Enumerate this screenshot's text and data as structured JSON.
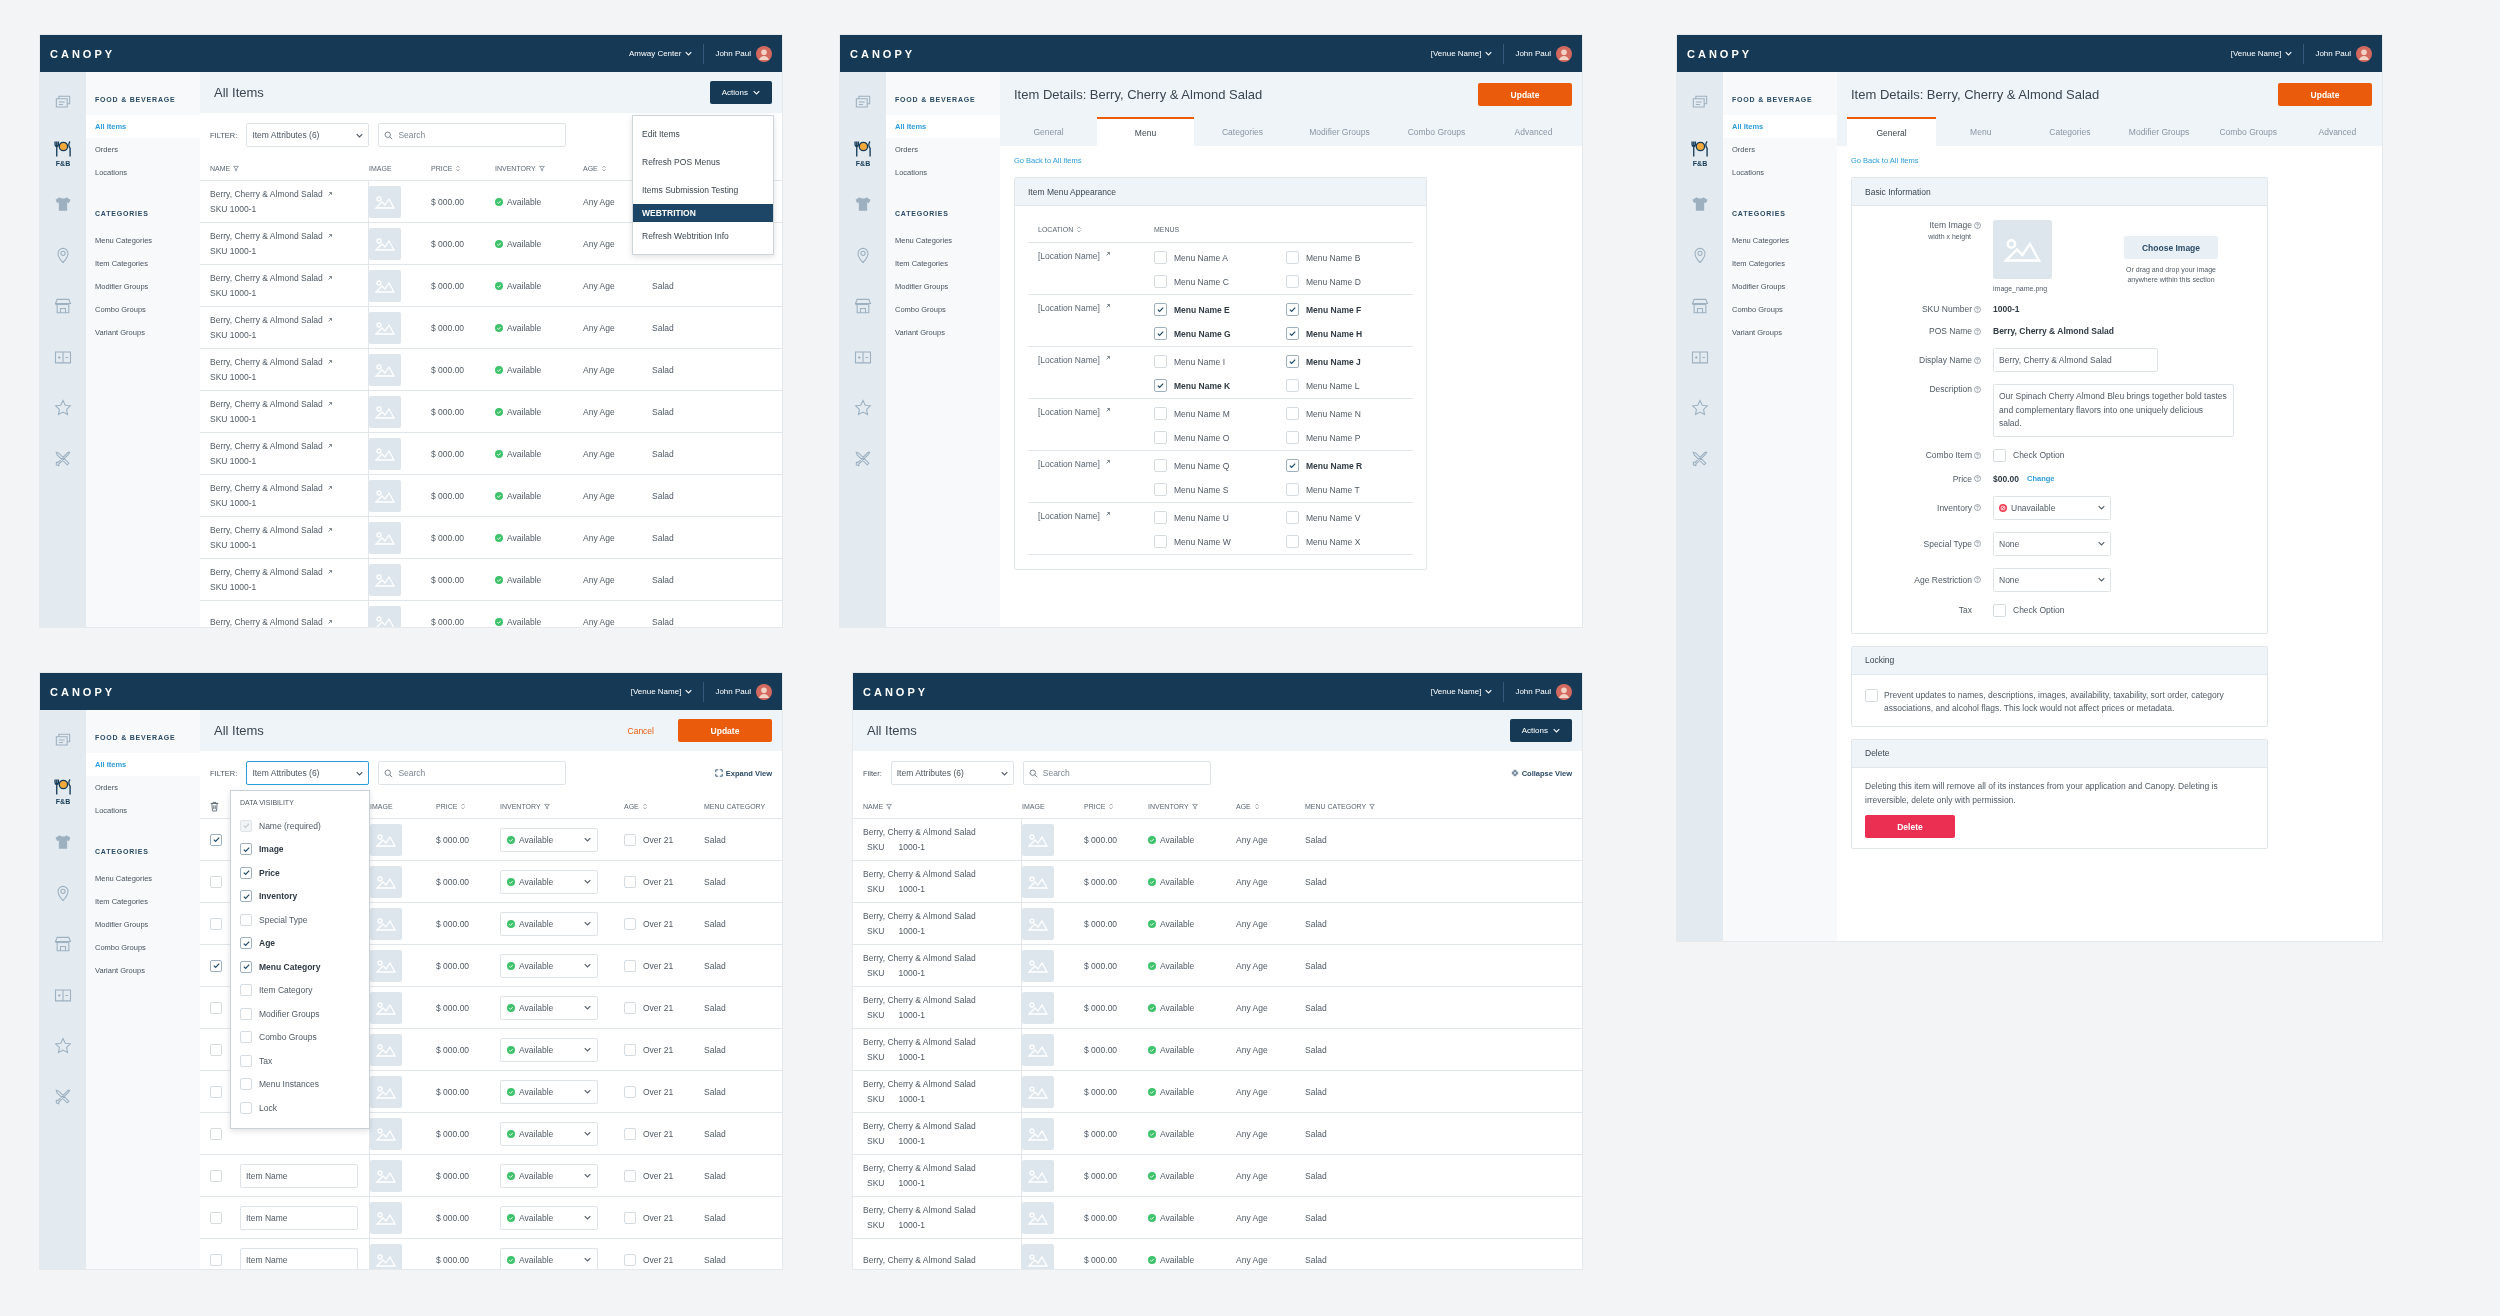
{
  "screens": [
    {
      "kind": "list",
      "topbar": {
        "logo": "CANOPY",
        "venue": "Amway Center",
        "user": "John Paul"
      },
      "rail": [
        {
          "kind": "tickets",
          "selected": false
        },
        {
          "kind": "food",
          "label": "F&B",
          "selected": true
        },
        {
          "kind": "shirt",
          "selected": false
        },
        {
          "kind": "pin",
          "selected": false
        },
        {
          "kind": "store",
          "selected": false
        },
        {
          "kind": "panels",
          "selected": false
        },
        {
          "kind": "star",
          "selected": false
        },
        {
          "kind": "tools",
          "selected": false
        }
      ],
      "sidebar": {
        "sections": [
          {
            "title": "FOOD & BEVERAGE",
            "items": [
              {
                "label": "All Items",
                "selected": true
              },
              {
                "label": "Orders",
                "selected": false
              },
              {
                "label": "Locations",
                "selected": false
              }
            ]
          },
          {
            "title": "CATEGORIES",
            "items": [
              {
                "label": "Menu Categories",
                "selected": false
              },
              {
                "label": "Item Categories",
                "selected": false
              },
              {
                "label": "Modifier Groups",
                "selected": false
              },
              {
                "label": "Combo Groups",
                "selected": false
              },
              {
                "label": "Variant Groups",
                "selected": false
              }
            ]
          }
        ]
      },
      "title": "All Items",
      "actions": [
        {
          "kind": "dropdown",
          "label": "Actions"
        }
      ],
      "filter": {
        "label": "FILTER:",
        "value": "Item Attributes (6)",
        "open": false
      },
      "search": {
        "placeholder": "Search"
      },
      "columns": [
        {
          "label": "NAME",
          "sortable": false,
          "filterable": true
        },
        {
          "label": "IMAGE",
          "sortable": false,
          "filterable": false
        },
        {
          "label": "PRICE",
          "sortable": true,
          "filterable": false
        },
        {
          "label": "INVENTORY",
          "sortable": false,
          "filterable": true
        },
        {
          "label": "AGE",
          "sortable": true,
          "filterable": false
        }
      ],
      "rows": [
        {
          "name": "Berry, Cherry & Almond Salad",
          "sku": "SKU 1000-1",
          "linked": true,
          "price": "$ 000.00",
          "inventory": "Available",
          "age": "Any Age"
        },
        {
          "name": "Berry, Cherry & Almond Salad",
          "sku": "SKU 1000-1",
          "linked": true,
          "price": "$ 000.00",
          "inventory": "Available",
          "age": "Any Age"
        },
        {
          "name": "Berry, Cherry & Almond Salad",
          "sku": "SKU 1000-1",
          "linked": true,
          "price": "$ 000.00",
          "inventory": "Available",
          "age": "Any Age",
          "category": "Salad"
        },
        {
          "name": "Berry, Cherry & Almond Salad",
          "sku": "SKU 1000-1",
          "linked": true,
          "price": "$ 000.00",
          "inventory": "Available",
          "age": "Any Age",
          "category": "Salad"
        },
        {
          "name": "Berry, Cherry & Almond Salad",
          "sku": "SKU 1000-1",
          "linked": true,
          "price": "$ 000.00",
          "inventory": "Available",
          "age": "Any Age",
          "category": "Salad"
        },
        {
          "name": "Berry, Cherry & Almond Salad",
          "sku": "SKU 1000-1",
          "linked": true,
          "price": "$ 000.00",
          "inventory": "Available",
          "age": "Any Age",
          "category": "Salad"
        },
        {
          "name": "Berry, Cherry & Almond Salad",
          "sku": "SKU 1000-1",
          "linked": true,
          "price": "$ 000.00",
          "inventory": "Available",
          "age": "Any Age",
          "category": "Salad"
        },
        {
          "name": "Berry, Cherry & Almond Salad",
          "sku": "SKU 1000-1",
          "linked": true,
          "price": "$ 000.00",
          "inventory": "Available",
          "age": "Any Age",
          "category": "Salad"
        },
        {
          "name": "Berry, Cherry & Almond Salad",
          "sku": "SKU 1000-1",
          "linked": true,
          "price": "$ 000.00",
          "inventory": "Available",
          "age": "Any Age",
          "category": "Salad"
        },
        {
          "name": "Berry, Cherry & Almond Salad",
          "sku": "SKU 1000-1",
          "linked": true,
          "price": "$ 000.00",
          "inventory": "Available",
          "age": "Any Age",
          "category": "Salad"
        },
        {
          "name": "Berry, Cherry & Almond Salad",
          "linked": true,
          "price": "$ 000.00",
          "inventory": "Available",
          "age": "Any Age",
          "category": "Salad"
        }
      ],
      "menu": {
        "items": [
          {
            "kind": "item",
            "label": "Edit Items"
          },
          {
            "kind": "item",
            "label": "Refresh POS Menus"
          },
          {
            "kind": "item",
            "label": "Items Submission Testing"
          },
          {
            "kind": "heading",
            "label": "WEBTRITION"
          },
          {
            "kind": "item",
            "label": "Refresh Webtrition Info"
          }
        ]
      }
    },
    {
      "kind": "menu",
      "topbar": {
        "logo": "CANOPY",
        "venue": "[Venue Name]",
        "user": "John Paul"
      },
      "rail": [
        {
          "kind": "tickets",
          "selected": false
        },
        {
          "kind": "food",
          "label": "F&B",
          "selected": true
        },
        {
          "kind": "shirt",
          "selected": false
        },
        {
          "kind": "pin",
          "selected": false
        },
        {
          "kind": "store",
          "selected": false
        },
        {
          "kind": "panels",
          "selected": false
        },
        {
          "kind": "star",
          "selected": false
        },
        {
          "kind": "tools",
          "selected": false
        }
      ],
      "sidebar": {
        "sections": [
          {
            "title": "FOOD & BEVERAGE",
            "items": [
              {
                "label": "All Items",
                "selected": true
              },
              {
                "label": "Orders",
                "selected": false
              },
              {
                "label": "Locations",
                "selected": false
              }
            ]
          },
          {
            "title": "CATEGORIES",
            "items": [
              {
                "label": "Menu Categories",
                "selected": false
              },
              {
                "label": "Item Categories",
                "selected": false
              },
              {
                "label": "Modifier Groups",
                "selected": false
              },
              {
                "label": "Combo Groups",
                "selected": false
              },
              {
                "label": "Variant Groups",
                "selected": false
              }
            ]
          }
        ]
      },
      "title": "Item Details: Berry, Cherry & Almond Salad",
      "actions": [
        {
          "kind": "primary",
          "label": "Update"
        }
      ],
      "tabs": [
        {
          "label": "General",
          "selected": false
        },
        {
          "label": "Menu",
          "selected": true
        },
        {
          "label": "Categories",
          "selected": false
        },
        {
          "label": "Modifier Groups",
          "selected": false
        },
        {
          "label": "Combo Groups",
          "selected": false
        },
        {
          "label": "Advanced",
          "selected": false
        }
      ],
      "back_link": "Go Back to All Items",
      "panel": {
        "title": "Item Menu Appearance",
        "location_header": "LOCATION",
        "menus_header": "MENUS",
        "groups": [
          {
            "location": "[Location Name]",
            "menus": [
              {
                "label": "Menu Name A",
                "checked": false
              },
              {
                "label": "Menu Name B",
                "checked": false
              },
              {
                "label": "Menu Name C",
                "checked": false
              },
              {
                "label": "Menu Name D",
                "checked": false
              }
            ]
          },
          {
            "location": "[Location Name]",
            "menus": [
              {
                "label": "Menu Name E",
                "checked": true
              },
              {
                "label": "Menu Name F",
                "checked": true
              },
              {
                "label": "Menu Name G",
                "checked": true
              },
              {
                "label": "Menu Name H",
                "checked": true
              }
            ]
          },
          {
            "location": "[Location Name]",
            "menus": [
              {
                "label": "Menu Name I",
                "checked": false
              },
              {
                "label": "Menu Name J",
                "checked": true
              },
              {
                "label": "Menu Name K",
                "checked": true
              },
              {
                "label": "Menu Name L",
                "checked": false
              }
            ]
          },
          {
            "location": "[Location Name]",
            "menus": [
              {
                "label": "Menu Name M",
                "checked": false
              },
              {
                "label": "Menu Name N",
                "checked": false
              },
              {
                "label": "Menu Name O",
                "checked": false
              },
              {
                "label": "Menu Name P",
                "checked": false
              }
            ]
          },
          {
            "location": "[Location Name]",
            "menus": [
              {
                "label": "Menu Name Q",
                "checked": false
              },
              {
                "label": "Menu Name R",
                "checked": true
              },
              {
                "label": "Menu Name S",
                "checked": false
              },
              {
                "label": "Menu Name T",
                "checked": false
              }
            ]
          },
          {
            "location": "[Location Name]",
            "menus": [
              {
                "label": "Menu Name U",
                "checked": false
              },
              {
                "label": "Menu Name V",
                "checked": false
              },
              {
                "label": "Menu Name W",
                "checked": false
              },
              {
                "label": "Menu Name X",
                "checked": false
              }
            ]
          }
        ]
      }
    },
    {
      "kind": "general",
      "topbar": {
        "logo": "CANOPY",
        "venue": "[Venue Name]",
        "user": "John Paul"
      },
      "rail": [
        {
          "kind": "tickets",
          "selected": false
        },
        {
          "kind": "food",
          "label": "F&B",
          "selected": true
        },
        {
          "kind": "shirt",
          "selected": false
        },
        {
          "kind": "pin",
          "selected": false
        },
        {
          "kind": "store",
          "selected": false
        },
        {
          "kind": "panels",
          "selected": false
        },
        {
          "kind": "star",
          "selected": false
        },
        {
          "kind": "tools",
          "selected": false
        }
      ],
      "sidebar": {
        "sections": [
          {
            "title": "FOOD & BEVERAGE",
            "items": [
              {
                "label": "All Items",
                "selected": true
              },
              {
                "label": "Orders",
                "selected": false
              },
              {
                "label": "Locations",
                "selected": false
              }
            ]
          },
          {
            "title": "CATEGORIES",
            "items": [
              {
                "label": "Menu Categories",
                "selected": false
              },
              {
                "label": "Item Categories",
                "selected": false
              },
              {
                "label": "Modifier Groups",
                "selected": false
              },
              {
                "label": "Combo Groups",
                "selected": false
              },
              {
                "label": "Variant Groups",
                "selected": false
              }
            ]
          }
        ]
      },
      "title": "Item Details: Berry, Cherry & Almond Salad",
      "actions": [
        {
          "kind": "primary",
          "label": "Update"
        }
      ],
      "tabs": [
        {
          "label": "General",
          "selected": true
        },
        {
          "label": "Menu",
          "selected": false
        },
        {
          "label": "Categories",
          "selected": false
        },
        {
          "label": "Modifier Groups",
          "selected": false
        },
        {
          "label": "Combo Groups",
          "selected": false
        },
        {
          "label": "Advanced",
          "selected": false
        }
      ],
      "back_link": "Go Back to All Items",
      "basic": {
        "title": "Basic Information",
        "fields": [
          {
            "kind": "image",
            "label": "Item Image",
            "help": true,
            "sublabel": "width x height",
            "caption": "image_name.png",
            "button": "Choose Image",
            "hint": "Or drag and drop your image anywhere within this section"
          },
          {
            "kind": "text",
            "label": "SKU Number",
            "help": true,
            "value": "1000-1"
          },
          {
            "kind": "text",
            "label": "POS Name",
            "help": true,
            "value": "Berry, Cherry & Almond Salad"
          },
          {
            "kind": "input",
            "label": "Display Name",
            "help": true,
            "value": "Berry, Cherry & Almond Salad"
          },
          {
            "kind": "textarea",
            "label": "Description",
            "help": true,
            "value": "Our Spinach Cherry Almond Bleu brings together bold tastes and complementary flavors into one uniquely delicious salad."
          },
          {
            "kind": "checkbox",
            "label": "Combo Item",
            "help": true,
            "option": "Check Option",
            "checked": false
          },
          {
            "kind": "price",
            "label": "Price",
            "help": true,
            "value": "$00.00",
            "link": "Change"
          },
          {
            "kind": "select",
            "label": "Inventory",
            "help": true,
            "value": "Unavailable",
            "available": false
          },
          {
            "kind": "select",
            "label": "Special Type",
            "help": true,
            "value": "None"
          },
          {
            "kind": "select",
            "label": "Age Restriction",
            "help": true,
            "value": "None"
          },
          {
            "kind": "checkbox",
            "label": "Tax",
            "help": false,
            "option": "Check Option",
            "checked": false
          }
        ]
      },
      "locking": {
        "title": "Locking",
        "checked": false,
        "text": "Prevent updates to names, descriptions, images, availability, taxability, sort order, category associations, and alcohol flags. This lock would not affect prices or metadata."
      },
      "delete_section": {
        "title": "Delete",
        "text": "Deleting this item will remove all of its instances from your application and Canopy. Deleting is irreversible, delete only with permission.",
        "button": "Delete"
      }
    },
    {
      "kind": "edit",
      "topbar": {
        "logo": "CANOPY",
        "venue": "[Venue Name]",
        "user": "John Paul"
      },
      "rail": [
        {
          "kind": "tickets",
          "selected": false
        },
        {
          "kind": "food",
          "label": "F&B",
          "selected": true
        },
        {
          "kind": "shirt",
          "selected": false
        },
        {
          "kind": "pin",
          "selected": false
        },
        {
          "kind": "store",
          "selected": false
        },
        {
          "kind": "panels",
          "selected": false
        },
        {
          "kind": "star",
          "selected": false
        },
        {
          "kind": "tools",
          "selected": false
        }
      ],
      "sidebar": {
        "sections": [
          {
            "title": "FOOD & BEVERAGE",
            "items": [
              {
                "label": "All Items",
                "selected": true
              },
              {
                "label": "Orders",
                "selected": false
              },
              {
                "label": "Locations",
                "selected": false
              }
            ]
          },
          {
            "title": "CATEGORIES",
            "items": [
              {
                "label": "Menu Categories",
                "selected": false
              },
              {
                "label": "Item Categories",
                "selected": false
              },
              {
                "label": "Modifier Groups",
                "selected": false
              },
              {
                "label": "Combo Groups",
                "selected": false
              },
              {
                "label": "Variant Groups",
                "selected": false
              }
            ]
          }
        ]
      },
      "title": "All Items",
      "actions": [
        {
          "kind": "link",
          "label": "Cancel"
        },
        {
          "kind": "primary",
          "label": "Update"
        }
      ],
      "filter": {
        "label": "FILTER:",
        "value": "Item Attributes (6)",
        "open": true
      },
      "search": {
        "placeholder": "Search"
      },
      "view_toggle": {
        "kind": "expand",
        "label": "Expand View"
      },
      "columns": [
        {
          "label": "IMAGE",
          "sortable": false,
          "filterable": false
        },
        {
          "label": "PRICE",
          "sortable": true,
          "filterable": false
        },
        {
          "label": "INVENTORY",
          "sortable": false,
          "filterable": true
        },
        {
          "label": "AGE",
          "sortable": true,
          "filterable": false
        },
        {
          "label": "MENU CATEGORY",
          "sortable": false,
          "filterable": false
        }
      ],
      "rows": [
        {
          "selected": true,
          "price": "$ 000.00",
          "inventory": "Available",
          "age": "Over 21",
          "age_checked": false,
          "category": "Salad"
        },
        {
          "selected": false,
          "price": "$ 000.00",
          "inventory": "Available",
          "age": "Over 21",
          "age_checked": false,
          "category": "Salad"
        },
        {
          "selected": false,
          "price": "$ 000.00",
          "inventory": "Available",
          "age": "Over 21",
          "age_checked": false,
          "category": "Salad"
        },
        {
          "selected": true,
          "price": "$ 000.00",
          "inventory": "Available",
          "age": "Over 21",
          "age_checked": false,
          "category": "Salad"
        },
        {
          "selected": false,
          "price": "$ 000.00",
          "inventory": "Available",
          "age": "Over 21",
          "age_checked": false,
          "category": "Salad"
        },
        {
          "selected": false,
          "price": "$ 000.00",
          "inventory": "Available",
          "age": "Over 21",
          "age_checked": false,
          "category": "Salad"
        },
        {
          "selected": false,
          "price": "$ 000.00",
          "inventory": "Available",
          "age": "Over 21",
          "age_checked": false,
          "category": "Salad"
        },
        {
          "selected": false,
          "price": "$ 000.00",
          "inventory": "Available",
          "age": "Over 21",
          "age_checked": false,
          "category": "Salad"
        },
        {
          "selected": false,
          "name": "Item Name",
          "price": "$ 000.00",
          "inventory": "Available",
          "age": "Over 21",
          "age_checked": false,
          "category": "Salad"
        },
        {
          "selected": false,
          "name": "Item Name",
          "price": "$ 000.00",
          "inventory": "Available",
          "age": "Over 21",
          "age_checked": false,
          "category": "Salad"
        },
        {
          "selected": false,
          "name": "Item Name",
          "price": "$ 000.00",
          "inventory": "Available",
          "age": "Over 21",
          "age_checked": false,
          "category": "Salad"
        }
      ],
      "visibility_menu": {
        "title": "DATA VISIBILITY",
        "options": [
          {
            "label": "Name (required)",
            "checked": true,
            "disabled": true
          },
          {
            "label": "Image",
            "checked": true,
            "disabled": false
          },
          {
            "label": "Price",
            "checked": true,
            "disabled": false
          },
          {
            "label": "Inventory",
            "checked": true,
            "disabled": false
          },
          {
            "label": "Special Type",
            "checked": false,
            "disabled": false
          },
          {
            "label": "Age",
            "checked": true,
            "disabled": false
          },
          {
            "label": "Menu Category",
            "checked": true,
            "disabled": false
          },
          {
            "label": "Item Category",
            "checked": false,
            "disabled": false
          },
          {
            "label": "Modifier Groups",
            "checked": false,
            "disabled": false
          },
          {
            "label": "Combo Groups",
            "checked": false,
            "disabled": false
          },
          {
            "label": "Tax",
            "checked": false,
            "disabled": false
          },
          {
            "label": "Menu Instances",
            "checked": false,
            "disabled": false
          },
          {
            "label": "Lock",
            "checked": false,
            "disabled": false
          }
        ]
      }
    },
    {
      "kind": "list",
      "topbar": {
        "logo": "CANOPY",
        "venue": "[Venue Name]",
        "user": "John Paul"
      },
      "title": "All Items",
      "actions": [
        {
          "kind": "dropdown",
          "label": "Actions"
        }
      ],
      "filter": {
        "label": "Filter:",
        "value": "Item Attributes (6)",
        "open": false
      },
      "search": {
        "placeholder": "Search"
      },
      "view_toggle": {
        "kind": "collapse",
        "label": "Collapse View"
      },
      "columns": [
        {
          "label": "NAME",
          "sortable": false,
          "filterable": true
        },
        {
          "label": "IMAGE",
          "sortable": false,
          "filterable": false
        },
        {
          "label": "PRICE",
          "sortable": true,
          "filterable": false
        },
        {
          "label": "INVENTORY",
          "sortable": false,
          "filterable": true
        },
        {
          "label": "AGE",
          "sortable": true,
          "filterable": false
        },
        {
          "label": "MENU CATEGORY",
          "sortable": false,
          "filterable": true
        }
      ],
      "rows": [
        {
          "name": "Berry, Cherry & Almond Salad",
          "sku_label": "SKU",
          "sku": "1000-1",
          "linked": false,
          "price": "$ 000.00",
          "inventory": "Available",
          "age": "Any Age",
          "category": "Salad"
        },
        {
          "name": "Berry, Cherry & Almond Salad",
          "sku_label": "SKU",
          "sku": "1000-1",
          "linked": false,
          "price": "$ 000.00",
          "inventory": "Available",
          "age": "Any Age",
          "category": "Salad"
        },
        {
          "name": "Berry, Cherry & Almond Salad",
          "sku_label": "SKU",
          "sku": "1000-1",
          "linked": false,
          "price": "$ 000.00",
          "inventory": "Available",
          "age": "Any Age",
          "category": "Salad"
        },
        {
          "name": "Berry, Cherry & Almond Salad",
          "sku_label": "SKU",
          "sku": "1000-1",
          "linked": false,
          "price": "$ 000.00",
          "inventory": "Available",
          "age": "Any Age",
          "category": "Salad"
        },
        {
          "name": "Berry, Cherry & Almond Salad",
          "sku_label": "SKU",
          "sku": "1000-1",
          "linked": false,
          "price": "$ 000.00",
          "inventory": "Available",
          "age": "Any Age",
          "category": "Salad"
        },
        {
          "name": "Berry, Cherry & Almond Salad",
          "sku_label": "SKU",
          "sku": "1000-1",
          "linked": false,
          "price": "$ 000.00",
          "inventory": "Available",
          "age": "Any Age",
          "category": "Salad"
        },
        {
          "name": "Berry, Cherry & Almond Salad",
          "sku_label": "SKU",
          "sku": "1000-1",
          "linked": false,
          "price": "$ 000.00",
          "inventory": "Available",
          "age": "Any Age",
          "category": "Salad"
        },
        {
          "name": "Berry, Cherry & Almond Salad",
          "sku_label": "SKU",
          "sku": "1000-1",
          "linked": false,
          "price": "$ 000.00",
          "inventory": "Available",
          "age": "Any Age",
          "category": "Salad"
        },
        {
          "name": "Berry, Cherry & Almond Salad",
          "sku_label": "SKU",
          "sku": "1000-1",
          "linked": false,
          "price": "$ 000.00",
          "inventory": "Available",
          "age": "Any Age",
          "category": "Salad"
        },
        {
          "name": "Berry, Cherry & Almond Salad",
          "sku_label": "SKU",
          "sku": "1000-1",
          "linked": false,
          "price": "$ 000.00",
          "inventory": "Available",
          "age": "Any Age",
          "category": "Salad"
        },
        {
          "name": "Berry, Cherry & Almond Salad",
          "linked": false,
          "price": "$ 000.00",
          "inventory": "Available",
          "age": "Any Age",
          "category": "Salad"
        }
      ]
    }
  ]
}
